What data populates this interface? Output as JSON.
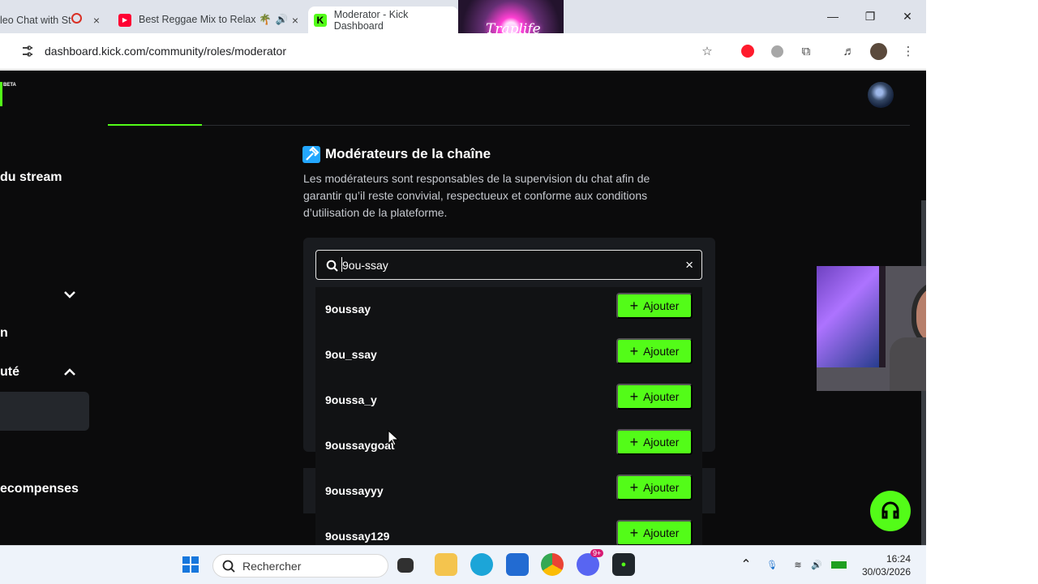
{
  "browser": {
    "tabs": [
      {
        "label": "leo Chat with St"
      },
      {
        "label": "Best Reggae Mix to Relax 🌴"
      },
      {
        "label": "Moderator - Kick Dashboard"
      }
    ],
    "url": "dashboard.kick.com/community/roles/moderator"
  },
  "sidebar": {
    "logo_badge": "BETA",
    "items": [
      {
        "label": "du stream"
      },
      {
        "label": "n"
      },
      {
        "label": "uté"
      },
      {
        "label": "ecompenses"
      }
    ]
  },
  "main": {
    "title": "Modérateurs de la chaîne",
    "description": "Les modérateurs sont responsables de la supervision du chat afin de garantir qu’il reste convivial, respectueux et conforme aux conditions d’utilisation de la plateforme.",
    "search_value": "9ou-ssay",
    "results": [
      {
        "name": "9oussay",
        "button": "Ajouter"
      },
      {
        "name": "9ou_ssay",
        "button": "Ajouter"
      },
      {
        "name": "9oussa_y",
        "button": "Ajouter"
      },
      {
        "name": "9oussaygoat",
        "button": "Ajouter"
      },
      {
        "name": "9oussayyy",
        "button": "Ajouter"
      },
      {
        "name": "9oussay129",
        "button": "Ajouter"
      }
    ]
  },
  "taskbar": {
    "search_placeholder": "Rechercher",
    "discord_badge": "9+",
    "time": "16:24",
    "date": "30/03/2026"
  },
  "overlay": {
    "stream_logo_text": "Traplife"
  },
  "colors": {
    "kick_green": "#53fc18",
    "page_bg": "#0b0b0c",
    "panel_bg": "#191b1f",
    "section_icon": "#23a7ff"
  }
}
